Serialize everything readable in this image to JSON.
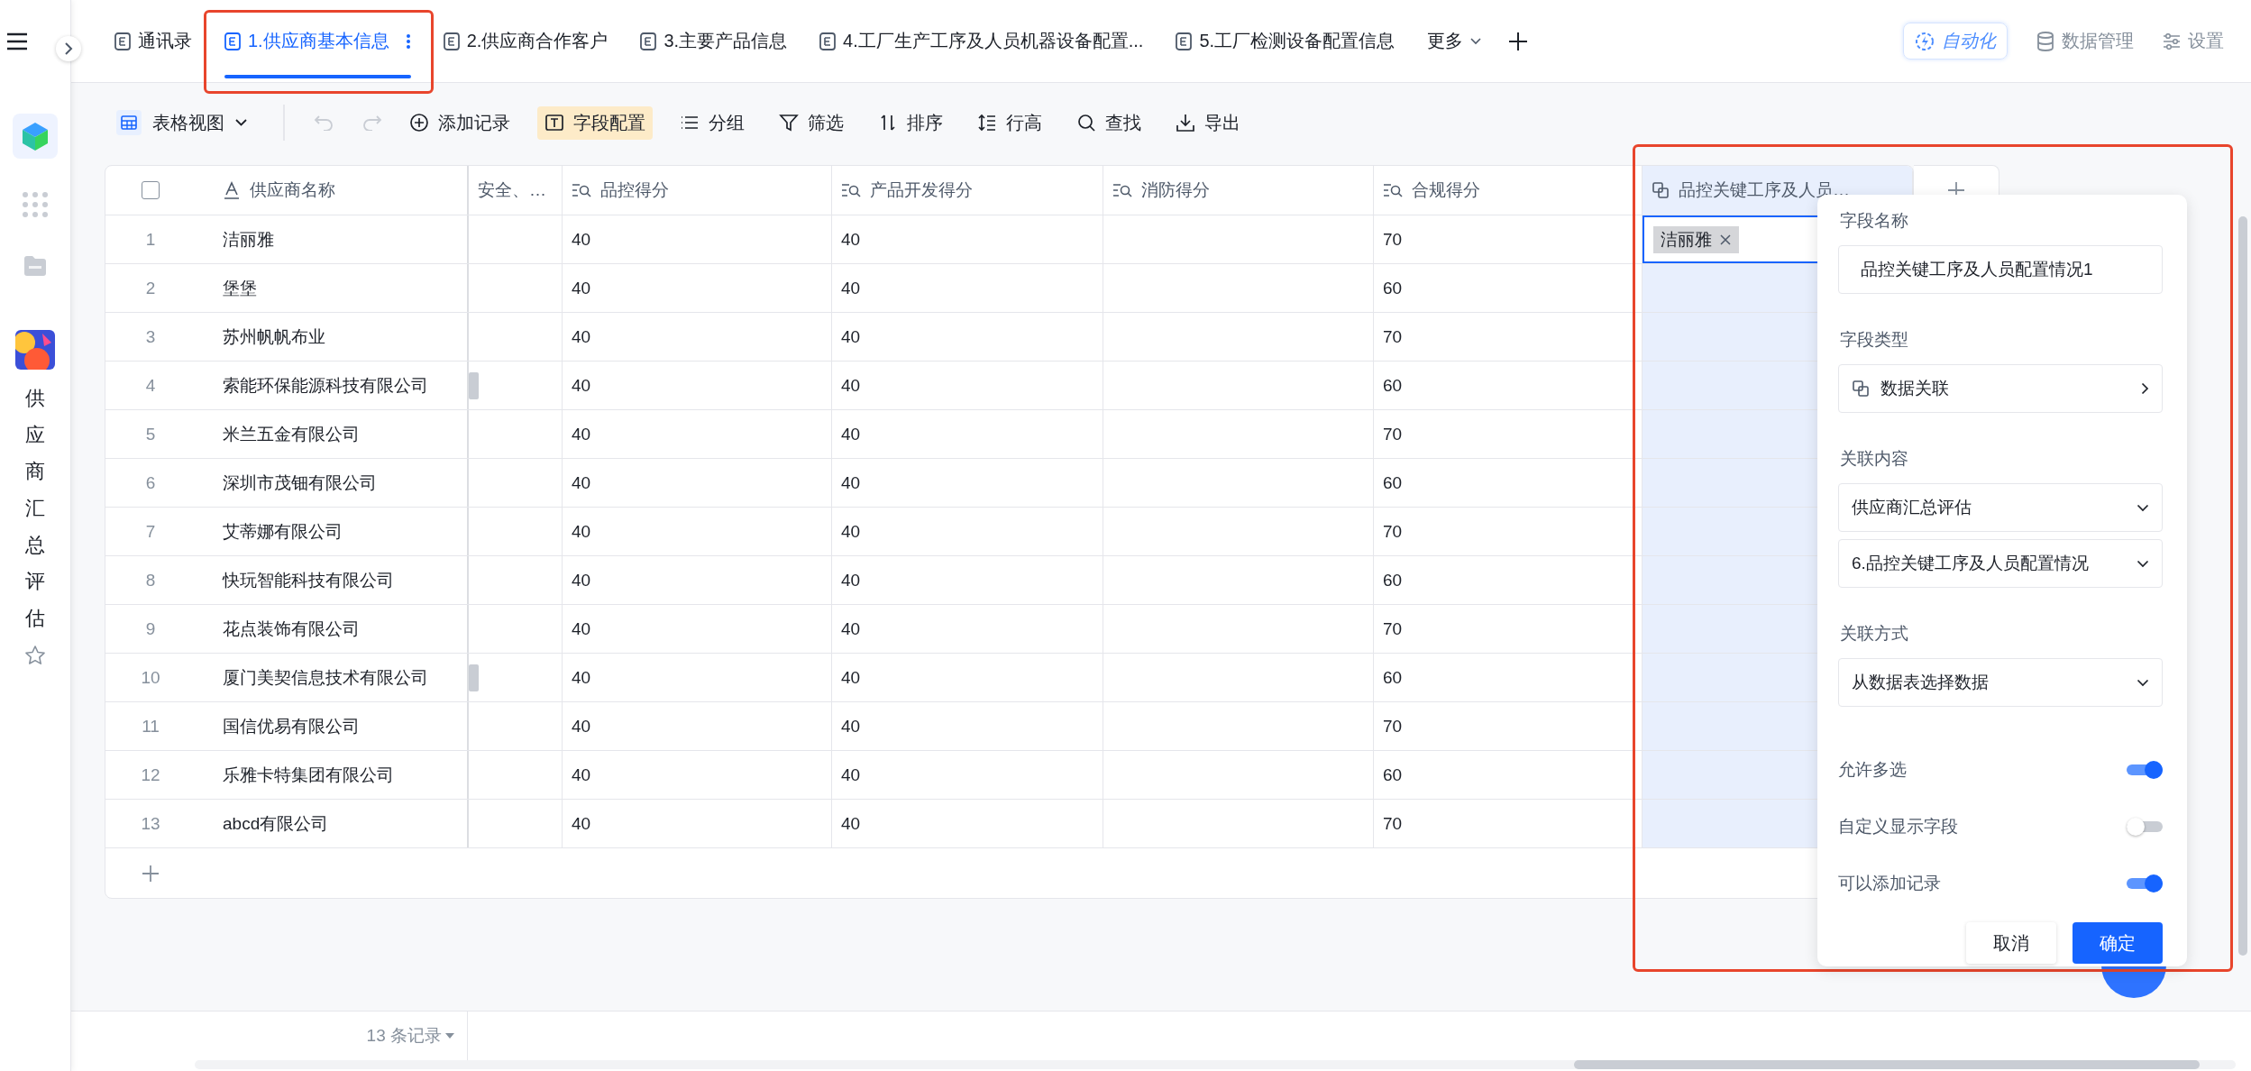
{
  "sidebar": {
    "app_name": "供应商汇总评估"
  },
  "tabs": [
    {
      "label": "通讯录",
      "selected": false,
      "annotated": false
    },
    {
      "label": "1.供应商基本信息",
      "selected": true,
      "annotated": true
    },
    {
      "label": "2.供应商合作客户",
      "selected": false,
      "annotated": false
    },
    {
      "label": "3.主要产品信息",
      "selected": false,
      "annotated": false
    },
    {
      "label": "4.工厂生产工序及人员机器设备配置...",
      "selected": false,
      "annotated": false
    },
    {
      "label": "5.工厂检测设备配置信息",
      "selected": false,
      "annotated": false
    }
  ],
  "more_tabs": "更多",
  "top_actions": [
    {
      "label": "自动化",
      "kind": "automation"
    },
    {
      "label": "数据管理",
      "kind": "data"
    },
    {
      "label": "设置",
      "kind": "settings"
    }
  ],
  "toolbar": {
    "view": "表格视图",
    "history": [
      {
        "kind": "undo",
        "disabled": true
      },
      {
        "kind": "redo",
        "disabled": true
      }
    ],
    "actions": [
      {
        "label": "添加记录",
        "kind": "add",
        "active": false
      },
      {
        "label": "字段配置",
        "kind": "fields",
        "active": true
      },
      {
        "label": "分组",
        "kind": "group",
        "active": false
      },
      {
        "label": "筛选",
        "kind": "filter",
        "active": false
      },
      {
        "label": "排序",
        "kind": "sort",
        "active": false
      },
      {
        "label": "行高",
        "kind": "row_height",
        "active": false
      },
      {
        "label": "查找",
        "kind": "search",
        "active": false
      },
      {
        "label": "导出",
        "kind": "export",
        "active": false
      }
    ]
  },
  "table": {
    "select_all_checked": false,
    "columns": [
      {
        "label": "供应商名称",
        "kind": "text",
        "selected": false
      },
      {
        "label": "安全、…",
        "kind": "clipped",
        "selected": false
      },
      {
        "label": "品控得分",
        "kind": "lookup",
        "selected": false
      },
      {
        "label": "产品开发得分",
        "kind": "lookup",
        "selected": false
      },
      {
        "label": "消防得分",
        "kind": "lookup",
        "selected": false
      },
      {
        "label": "合规得分",
        "kind": "lookup",
        "selected": false
      },
      {
        "label": "品控关键工序及人员…",
        "kind": "link",
        "selected": true
      }
    ],
    "rows": [
      {
        "index": "1",
        "supplier": "洁丽雅",
        "marker": false,
        "quality": "40",
        "development": "40",
        "compliance": "70",
        "linked": [
          "洁丽雅"
        ],
        "active": true
      },
      {
        "index": "2",
        "supplier": "堡堡",
        "marker": false,
        "quality": "40",
        "development": "40",
        "compliance": "60",
        "active": false
      },
      {
        "index": "3",
        "supplier": "苏州帆帆布业",
        "marker": false,
        "quality": "40",
        "development": "40",
        "compliance": "70",
        "active": false
      },
      {
        "index": "4",
        "supplier": "索能环保能源科技有限公司",
        "marker": true,
        "quality": "40",
        "development": "40",
        "compliance": "60",
        "active": false
      },
      {
        "index": "5",
        "supplier": "米兰五金有限公司",
        "marker": false,
        "quality": "40",
        "development": "40",
        "compliance": "70",
        "active": false
      },
      {
        "index": "6",
        "supplier": "深圳市茂钿有限公司",
        "marker": false,
        "quality": "40",
        "development": "40",
        "compliance": "60",
        "active": false
      },
      {
        "index": "7",
        "supplier": "艾蒂娜有限公司",
        "marker": false,
        "quality": "40",
        "development": "40",
        "compliance": "70",
        "active": false
      },
      {
        "index": "8",
        "supplier": "快玩智能科技有限公司",
        "marker": false,
        "quality": "40",
        "development": "40",
        "compliance": "60",
        "active": false
      },
      {
        "index": "9",
        "supplier": "花点装饰有限公司",
        "marker": false,
        "quality": "40",
        "development": "40",
        "compliance": "70",
        "active": false
      },
      {
        "index": "10",
        "supplier": "厦门美契信息技术有限公司",
        "marker": true,
        "quality": "40",
        "development": "40",
        "compliance": "60",
        "active": false
      },
      {
        "index": "11",
        "supplier": "国信优易有限公司",
        "marker": false,
        "quality": "40",
        "development": "40",
        "compliance": "70",
        "active": false
      },
      {
        "index": "12",
        "supplier": "乐雅卡特集团有限公司",
        "marker": false,
        "quality": "40",
        "development": "40",
        "compliance": "60",
        "active": false
      },
      {
        "index": "13",
        "supplier": "abcd有限公司",
        "marker": false,
        "quality": "40",
        "development": "40",
        "compliance": "70",
        "active": false
      }
    ]
  },
  "field_panel": {
    "annotated": true,
    "sections": [
      {
        "label": "字段名称",
        "fields": [
          {
            "kind": "input",
            "value": "品控关键工序及人员配置情况1"
          }
        ]
      },
      {
        "label": "字段类型",
        "fields": [
          {
            "kind": "type",
            "value": "数据关联"
          }
        ]
      },
      {
        "label": "关联内容",
        "fields": [
          {
            "kind": "select",
            "value": "供应商汇总评估"
          },
          {
            "kind": "select",
            "value": "6.品控关键工序及人员配置情况"
          }
        ]
      },
      {
        "label": "关联方式",
        "fields": [
          {
            "kind": "select",
            "value": "从数据表选择数据"
          }
        ]
      }
    ],
    "toggles": [
      {
        "label": "允许多选",
        "on": true
      },
      {
        "label": "自定义显示字段",
        "on": false
      },
      {
        "label": "可以添加记录",
        "on": true
      }
    ],
    "buttons": [
      {
        "label": "取消",
        "kind": "secondary"
      },
      {
        "label": "确定",
        "kind": "primary"
      }
    ]
  },
  "footer": {
    "record_count": "13 条记录"
  }
}
